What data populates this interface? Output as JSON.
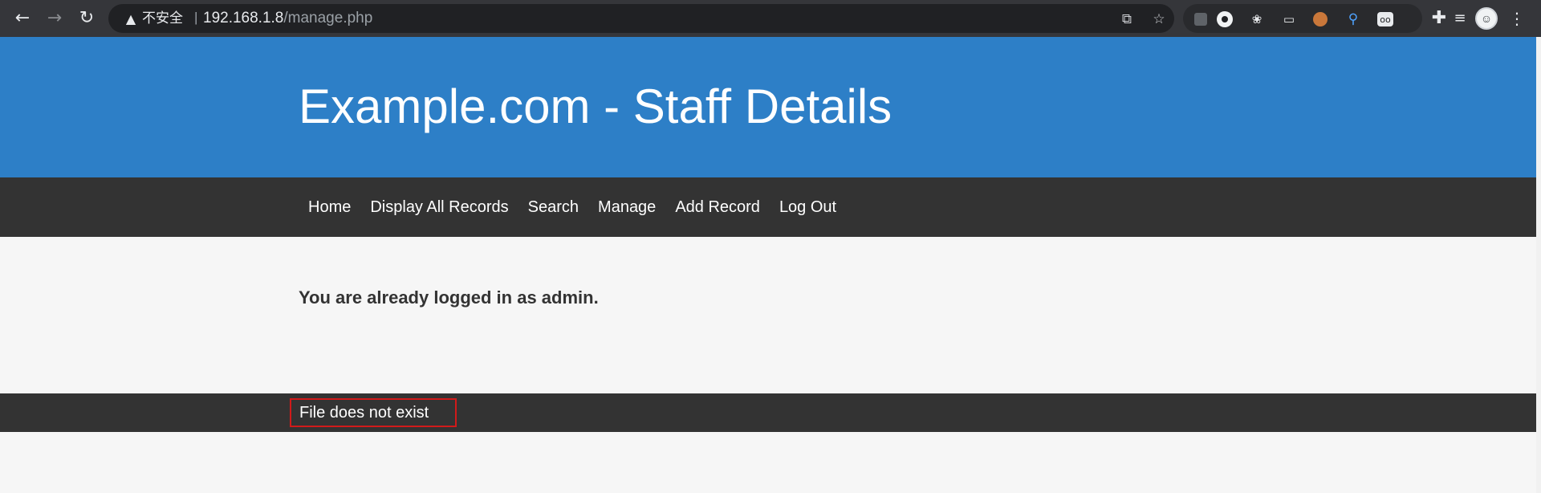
{
  "browser": {
    "security_label": "不安全",
    "url_separator": "|",
    "url_host": "192.168.1.8",
    "url_path": "/manage.php",
    "icons": [
      "back-icon",
      "forward-icon",
      "reload-icon",
      "warning-icon",
      "translate-icon",
      "bookmark-star-icon",
      "extensions-puzzle-icon",
      "reading-list-icon",
      "kebab-menu-icon"
    ]
  },
  "header": {
    "title": "Example.com - Staff Details",
    "background": "#2d7fc7"
  },
  "nav": {
    "items": [
      {
        "label": "Home"
      },
      {
        "label": "Display All Records"
      },
      {
        "label": "Search"
      },
      {
        "label": "Manage"
      },
      {
        "label": "Add Record"
      },
      {
        "label": "Log Out"
      }
    ],
    "background": "#333333"
  },
  "main": {
    "message": "You are already logged in as admin."
  },
  "footer": {
    "message": "File does not exist",
    "highlight_color": "#d11a1a"
  }
}
